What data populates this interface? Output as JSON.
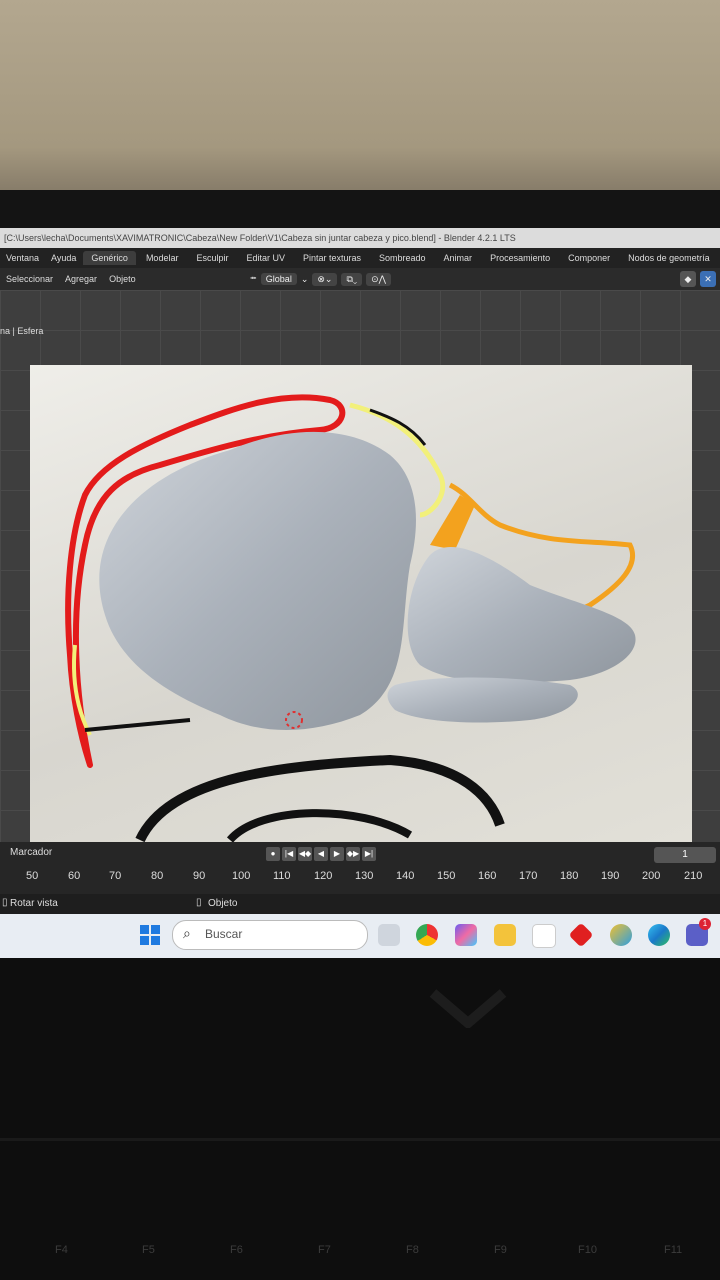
{
  "window": {
    "title": "[C:\\Users\\lecha\\Documents\\XAVIMATRONIC\\Cabeza\\New Folder\\V1\\Cabeza sin juntar cabeza y pico.blend] - Blender 4.2.1 LTS"
  },
  "menu": [
    "Ventana",
    "Ayuda"
  ],
  "workspaces": [
    "Genérico",
    "Modelar",
    "Esculpir",
    "Editar UV",
    "Pintar texturas",
    "Sombreado",
    "Animar",
    "Procesamiento",
    "Componer",
    "Nodos de geometría"
  ],
  "active_workspace": "Genérico",
  "toolbar": {
    "items": [
      "Seleccionar",
      "Agregar",
      "Objeto"
    ],
    "orientation": "Global"
  },
  "viewport": {
    "label": "na | Esfera"
  },
  "timeline": {
    "marker_label": "Marcador",
    "current_frame": "1",
    "ticks": [
      "50",
      "60",
      "70",
      "80",
      "90",
      "100",
      "110",
      "120",
      "130",
      "140",
      "150",
      "160",
      "170",
      "180",
      "190",
      "200",
      "210"
    ],
    "playback_glyphs": [
      "|◀",
      "◀◆",
      "◀",
      "▶",
      "◆▶",
      "▶|"
    ]
  },
  "status": {
    "left": "Rotar vista",
    "right": "Objeto"
  },
  "taskbar": {
    "search_placeholder": "Buscar",
    "notification_count": "1"
  },
  "keyboard": [
    "F4",
    "F5",
    "F6",
    "F7",
    "F8",
    "F9",
    "F10",
    "F11"
  ],
  "colors": {
    "red_stroke": "#e31b1b",
    "yellow_stroke": "#f2f07a",
    "orange_stroke": "#f3a21e",
    "mesh": "#b9c0c8"
  }
}
